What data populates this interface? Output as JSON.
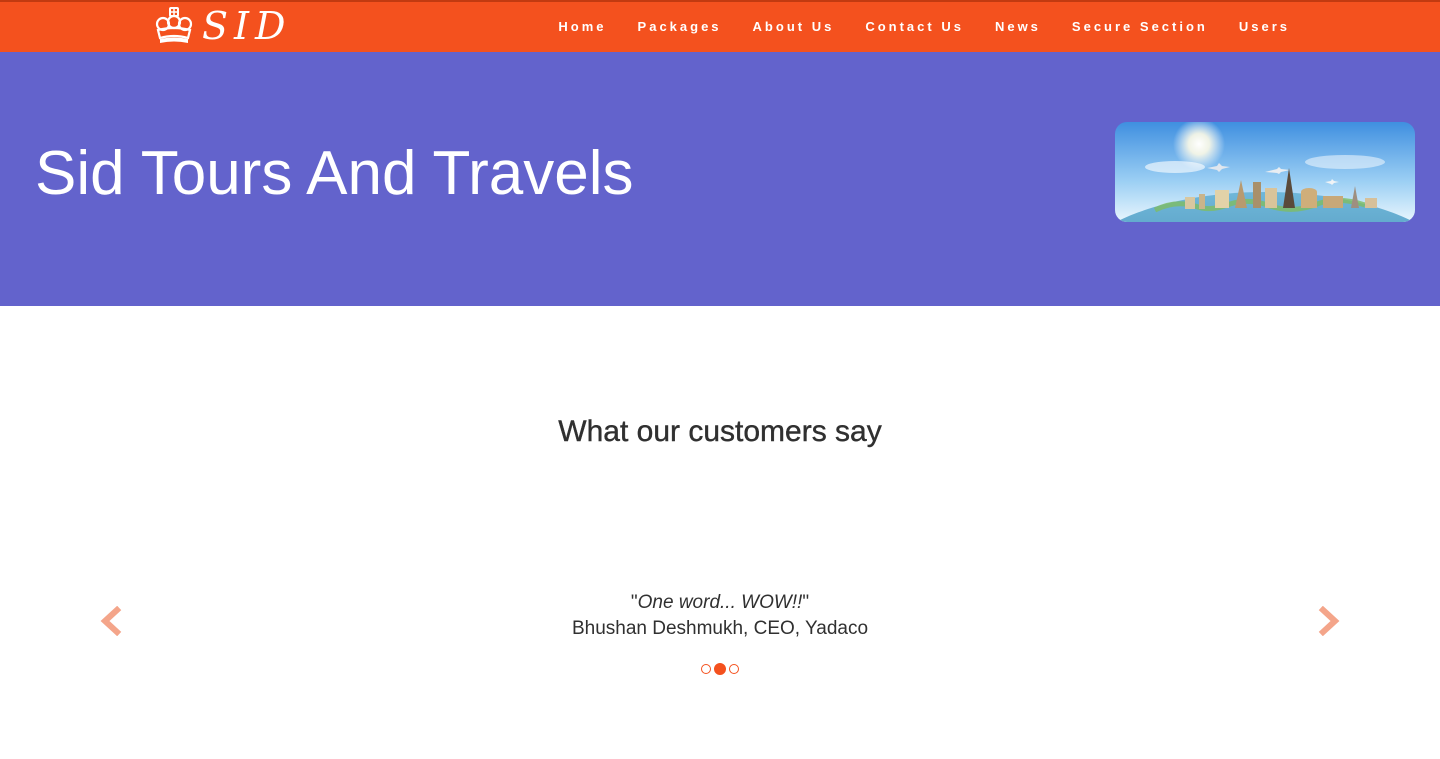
{
  "navbar": {
    "brand_text": "SID",
    "brand_icon": "crown-icon",
    "links": [
      "Home",
      "Packages",
      "About Us",
      "Contact Us",
      "News",
      "Secure Section",
      "Users"
    ]
  },
  "hero": {
    "title": "Sid Tours And Travels",
    "image": "world-landmarks-travel-image"
  },
  "testimonials": {
    "heading": "What our customers say",
    "slides": [
      {
        "quote": "One word... WOW!!",
        "author": "Bhushan Deshmukh, CEO, Yadaco"
      }
    ],
    "indicator_count": 3,
    "active_indicator": 1,
    "prev_icon": "chevron-left-icon",
    "next_icon": "chevron-right-icon"
  },
  "colors": {
    "navbar": "#f4511e",
    "hero": "#6363cc",
    "accent": "#f4511e",
    "arrow": "#f4a58a",
    "text": "#303030"
  }
}
